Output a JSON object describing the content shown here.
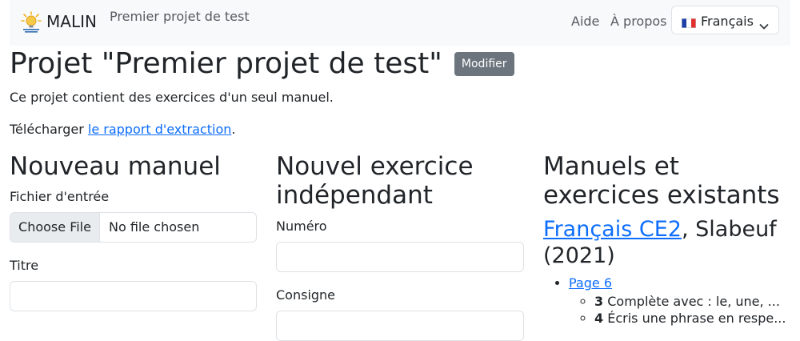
{
  "navbar": {
    "brand": "MALIN",
    "project": "Premier projet de test",
    "links": [
      "Aide",
      "À propos"
    ],
    "language": "Français"
  },
  "page": {
    "title": "Projet \"Premier projet de test\"",
    "edit_label": "Modifier",
    "description": "Ce projet contient des exercices d'un seul manuel.",
    "download_prefix": "Télécharger ",
    "download_link": "le rapport d'extraction",
    "download_suffix": "."
  },
  "new_manual": {
    "heading": "Nouveau manuel",
    "file_label": "Fichier d'entrée",
    "choose_file": "Choose File",
    "no_file": "No file chosen",
    "title_label": "Titre"
  },
  "new_exercise": {
    "heading": "Nouvel exercice indépendant",
    "number_label": "Numéro",
    "instruction_label": "Consigne"
  },
  "existing": {
    "heading": "Manuels et exercices existants",
    "manual_link": "Français CE2",
    "manual_rest": ", Slabeuf (2021)",
    "pages": [
      {
        "label": "Page 6",
        "exercises": [
          {
            "number": "3",
            "text": "Complète avec : le, une, ..."
          },
          {
            "number": "4",
            "text": "Écris une phrase en respe..."
          }
        ]
      }
    ]
  }
}
